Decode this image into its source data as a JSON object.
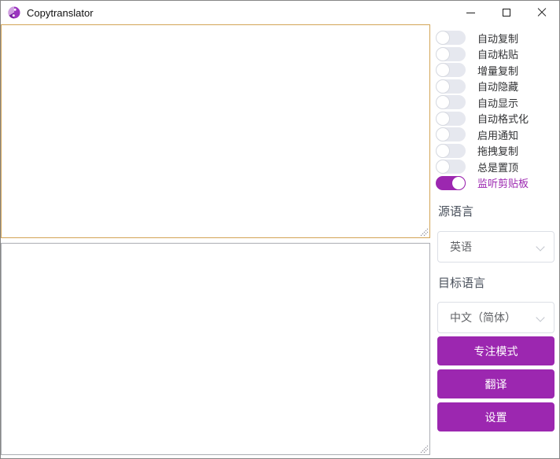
{
  "app": {
    "title": "Copytranslator"
  },
  "colors": {
    "accent_purple": "#9c27b0",
    "focused_border": "#d3a455",
    "idle_border": "#abadb3",
    "toggle_off_track": "#e6e8ef"
  },
  "icons": {
    "app_logo": "copytranslator-logo",
    "minimize": "–",
    "maximize": "□",
    "close": "✕",
    "dropdown_chevron": "⌄",
    "resize_grip": "◿"
  },
  "editor": {
    "source_text": "",
    "result_text": ""
  },
  "toggles": [
    {
      "label": "自动复制",
      "on": false
    },
    {
      "label": "自动粘贴",
      "on": false
    },
    {
      "label": "增量复制",
      "on": false
    },
    {
      "label": "自动隐藏",
      "on": false
    },
    {
      "label": "自动显示",
      "on": false
    },
    {
      "label": "自动格式化",
      "on": false
    },
    {
      "label": "启用通知",
      "on": false
    },
    {
      "label": "拖拽复制",
      "on": false
    },
    {
      "label": "总是置顶",
      "on": false
    },
    {
      "label": "监听剪贴板",
      "on": true
    }
  ],
  "language": {
    "source_label": "源语言",
    "source_value": "英语",
    "target_label": "目标语言",
    "target_value": "中文（简体）"
  },
  "actions": {
    "focus_mode": "专注模式",
    "translate": "翻译",
    "settings": "设置"
  }
}
